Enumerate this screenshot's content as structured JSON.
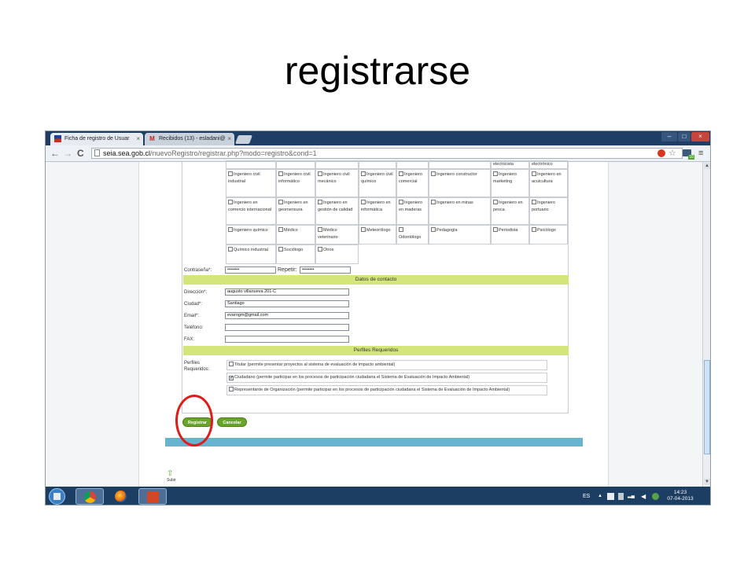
{
  "slide_title": "registrarse",
  "browser": {
    "tabs": [
      {
        "label": "Ficha de registro de Usuar",
        "close": "×"
      },
      {
        "label": "Recibidos (13) - esladani@",
        "close": "×"
      }
    ],
    "window_controls": {
      "minimize": "–",
      "maximize": "□",
      "close": "×"
    },
    "nav": {
      "back": "←",
      "forward": "→",
      "reload": "C"
    },
    "url_host": "seia.sea.gob.cl",
    "url_path": "/nuevoRegistro/registrar.php?modo=registro&cond=1",
    "tray_badge": "10"
  },
  "form": {
    "top_partial": [
      "electricista",
      "electrónico"
    ],
    "professions": [
      [
        "Ingeniero civil industrial",
        "Ingeniero civil informático",
        "Ingeniero civil mecánico",
        "Ingeniero civil químico",
        "Ingeniero comercial",
        "Ingeniero constructor",
        "Ingeniero marketing",
        "Ingeniero en acuicultura"
      ],
      [
        "Ingeniero en comercio internacional",
        "Ingeniero en geomensura",
        "Ingeniero en gestión de calidad",
        "Ingeniero en informática",
        "Ingeniero en maderas",
        "Ingeniero en minas",
        "Ingeniero en pesca",
        "Ingeniero portuario"
      ],
      [
        "Ingeniero químico",
        "Médico",
        "Médico veterinario",
        "Meteorólogo",
        "Odontólogo",
        "Pedagogía",
        "Periodista",
        "Psicólogo"
      ],
      [
        "Químico industrial",
        "Sociólogo",
        "Otros"
      ]
    ],
    "password_label": "Contraseña*:",
    "password_value": "••••••••",
    "repeat_label": "Repetir:",
    "repeat_value": "••••••••",
    "contact_header": "Datos de contacto",
    "direccion_label": "Dirección*:",
    "direccion_value": "augusto villanueva 201-C",
    "ciudad_label": "Ciudad*:",
    "ciudad_value": "Santiago",
    "email_label": "Email*:",
    "email_value": "evarogm@gmail.com",
    "telefono_label": "Teléfono:",
    "telefono_value": "",
    "fax_label": "FAX:",
    "fax_value": "",
    "perfiles_header": "Perfiles Requeridos",
    "perfiles_label": "Perfiles Requeridos:",
    "perfiles": [
      {
        "label": "Titular (permite presentar proyectos al sistema de evaluación de impacto ambiental)",
        "checked": false
      },
      {
        "label": "Ciudadano (permite participar en los procesos de participación ciudadana el Sistema de Evaluación de Impacto Ambiental)",
        "checked": true
      },
      {
        "label": "Representante de Organización (permite participar en los procesos de participación ciudadana el Sistema de Evaluación de Impacto Ambiental)",
        "checked": false
      }
    ],
    "registrar_button": "Registrar",
    "cancelar_button": "Cancelar"
  },
  "page_footer": {
    "up_icon": "⇧",
    "up_label": "Subir"
  },
  "taskbar": {
    "language": "ES",
    "time": "14:23",
    "date": "07-04-2013"
  },
  "colors": {
    "section_header": "#d4e57a",
    "button_green": "#6aa52b",
    "footer_bar": "#68b3cf",
    "highlight_ring": "#e01b1b"
  }
}
